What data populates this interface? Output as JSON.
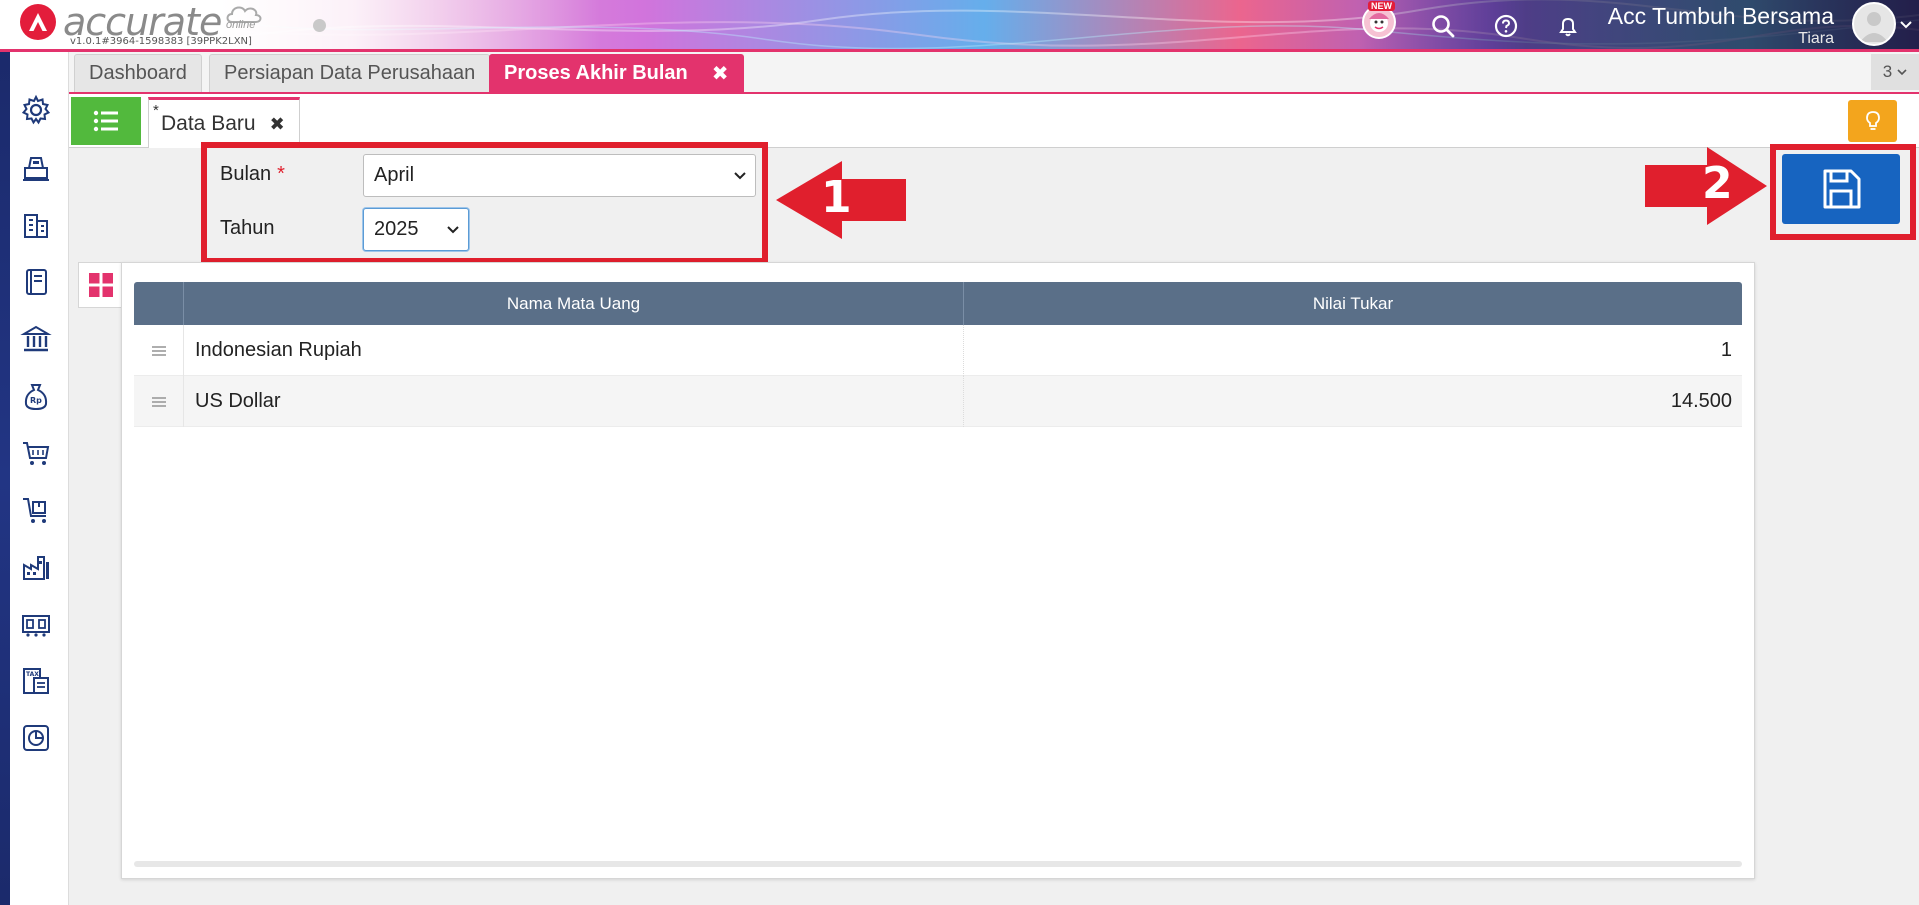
{
  "header": {
    "logo_text": "accurate",
    "logo_sub": "online",
    "version": "v1.0.1#3964-1598383 [39PPK2LXN]",
    "new_badge": "NEW",
    "company_name": "Acc Tumbuh Bersama",
    "user_name": "Tiara"
  },
  "tabs": {
    "items": [
      {
        "label": "Dashboard"
      },
      {
        "label": "Persiapan Data Perusahaan"
      },
      {
        "label": "Proses Akhir Bulan"
      }
    ],
    "close_glyph": "✖",
    "count": "3"
  },
  "subtab": {
    "star": "*",
    "label": "Data Baru",
    "close_glyph": "✖"
  },
  "form": {
    "bulan_label": "Bulan",
    "required_mark": "*",
    "bulan_value": "April",
    "tahun_label": "Tahun",
    "tahun_value": "2025"
  },
  "annotations": {
    "step1": "1",
    "step2": "2",
    "color": "#e01f2d"
  },
  "table": {
    "columns": [
      "Nama Mata Uang",
      "Nilai Tukar"
    ],
    "rows": [
      {
        "name": "Indonesian Rupiah",
        "rate": "1"
      },
      {
        "name": "US Dollar",
        "rate": "14.500"
      }
    ]
  },
  "colors": {
    "accent": "#e3336d",
    "save_button": "#1764c0",
    "list_button": "#52b93d",
    "hint_button": "#f3a51d",
    "table_header": "#5a6f88",
    "nav_bar": "#1b2a6b"
  },
  "sidebar_icons": [
    "gear-icon",
    "cashier-icon",
    "building-icon",
    "ledger-book-icon",
    "bank-icon",
    "money-bag-icon",
    "shopping-cart-icon",
    "delivery-cart-icon",
    "factory-icon",
    "warehouse-icon",
    "tax-document-icon",
    "report-chart-icon"
  ]
}
